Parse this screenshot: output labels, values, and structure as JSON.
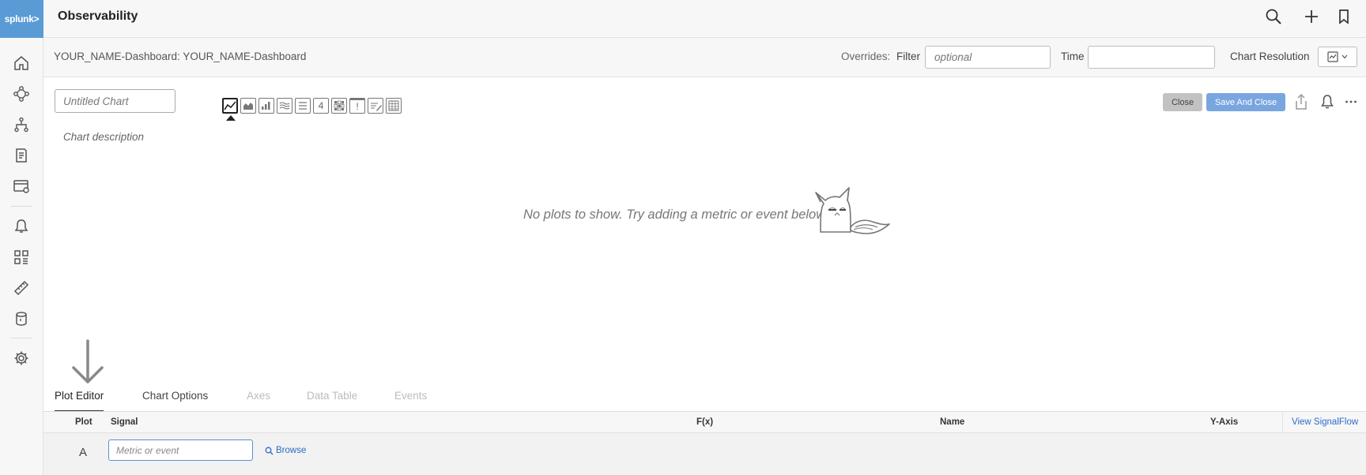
{
  "app": {
    "logo_text": "splunk>",
    "title": "Observability"
  },
  "nav": {
    "items": [
      "home-icon",
      "service-map-icon",
      "topology-icon",
      "logs-icon",
      "infrastructure-icon",
      "alerts-icon",
      "dashboards-icon",
      "ruler-icon",
      "database-icon",
      "settings-icon"
    ]
  },
  "header": {
    "icons": [
      "search-icon",
      "plus-icon",
      "bookmark-icon"
    ]
  },
  "overrides": {
    "breadcrumb": "YOUR_NAME-Dashboard: YOUR_NAME-Dashboard",
    "label": "Overrides:",
    "filter_label": "Filter",
    "filter_placeholder": "optional",
    "time_label": "Time",
    "time_value": "",
    "resolution_label": "Chart Resolution"
  },
  "chart": {
    "title_placeholder": "Untitled Chart",
    "description_placeholder": "Chart description",
    "types": [
      "line",
      "area",
      "column",
      "histogram",
      "list",
      "single-value",
      "heatmap",
      "event-feed",
      "text",
      "table"
    ],
    "active_type": "line",
    "single_value_glyph": "4",
    "event_feed_glyph": "!",
    "close_label": "Close",
    "save_label": "Save And Close",
    "empty_message": "No plots to show. Try adding a metric or event below."
  },
  "tabs": [
    {
      "label": "Plot Editor",
      "state": "active"
    },
    {
      "label": "Chart Options",
      "state": "enabled"
    },
    {
      "label": "Axes",
      "state": "disabled"
    },
    {
      "label": "Data Table",
      "state": "disabled"
    },
    {
      "label": "Events",
      "state": "disabled"
    }
  ],
  "plot_table": {
    "headers": {
      "plot": "Plot",
      "signal": "Signal",
      "fx": "F(x)",
      "name": "Name",
      "yaxis": "Y-Axis"
    },
    "signalflow_link": "View SignalFlow",
    "rows": [
      {
        "letter": "A",
        "signal_placeholder": "Metric or event",
        "browse_label": "Browse"
      }
    ]
  },
  "colors": {
    "brand": "#5b9bd5",
    "link": "#2a6bc9",
    "primary_button": "#7aa6e0"
  }
}
